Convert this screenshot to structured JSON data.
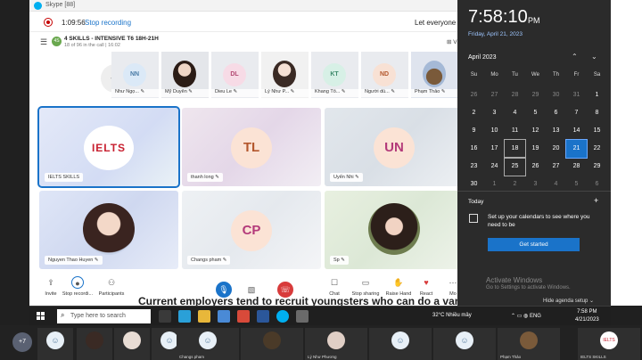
{
  "skype": {
    "window_title": "Skype [88]",
    "rec_time": "1:09:56",
    "stop_recording": "Stop recording",
    "marquee": "Let everyone kn",
    "group_name": "4 SKILLS - INTENSIVE T6 18H-21H",
    "group_sub": "18 of 96 in the call | 16:02",
    "group_avatar": "4S",
    "view_label": "Vi",
    "more_count": "+5"
  },
  "strip": [
    {
      "initials": "NN",
      "name": "Như Ngọ...",
      "color": "#dbe9f7",
      "text": "#4a7ba6"
    },
    {
      "initials": "",
      "name": "Mỹ Duyên",
      "color": "",
      "text": ""
    },
    {
      "initials": "DL",
      "name": "Dieu Le",
      "color": "#f7dbe6",
      "text": "#b34a73"
    },
    {
      "initials": "",
      "name": "Lý Như P...",
      "color": "",
      "text": ""
    },
    {
      "initials": "KT",
      "name": "Khang Tố...",
      "color": "#d7f0e6",
      "text": "#3f8a6c"
    },
    {
      "initials": "ND",
      "name": "Người dù...",
      "color": "#f8e1d4",
      "text": "#b3572d"
    },
    {
      "initials": "",
      "name": "Phạm Thảo",
      "color": "",
      "text": ""
    }
  ],
  "tiles": [
    {
      "name": "IELTS SKILLS",
      "initials": "IELTS"
    },
    {
      "name": "thanh long",
      "initials": "TL"
    },
    {
      "name": "Uyển Nhi",
      "initials": "UN"
    },
    {
      "name": "Nguyen Thao Huyen",
      "initials": ""
    },
    {
      "name": "Changs pham",
      "initials": "CP"
    },
    {
      "name": "Sp",
      "initials": ""
    }
  ],
  "controls": {
    "invite": "Invite",
    "stop_rec": "Stop recordi...",
    "participants": "Participants",
    "chat": "Chat",
    "stop_sharing": "Stop sharing",
    "raise_hand": "Raise Hand",
    "react": "React",
    "more": "Mo"
  },
  "background_text": "Current employers tend to recruit youngsters who can do a various am",
  "clock": {
    "time": "7:58:10",
    "ampm": "PM",
    "date": "Friday, April 21, 2023",
    "month": "April 2023",
    "dow": [
      "Su",
      "Mo",
      "Tu",
      "We",
      "Th",
      "Fr",
      "Sa"
    ],
    "weeks": [
      [
        "26",
        "27",
        "28",
        "29",
        "30",
        "31",
        "1"
      ],
      [
        "2",
        "3",
        "4",
        "5",
        "6",
        "7",
        "8"
      ],
      [
        "9",
        "10",
        "11",
        "12",
        "13",
        "14",
        "15"
      ],
      [
        "16",
        "17",
        "18",
        "19",
        "20",
        "21",
        "22"
      ],
      [
        "23",
        "24",
        "25",
        "26",
        "27",
        "28",
        "29"
      ],
      [
        "30",
        "1",
        "2",
        "3",
        "4",
        "5",
        "6"
      ]
    ],
    "today_label": "Today",
    "setup_text": "Set up your calendars to see where you need to be",
    "get_started": "Get started",
    "activate_title": "Activate Windows",
    "activate_sub": "Go to Settings to activate Windows.",
    "hide_agenda": "Hide agenda setup"
  },
  "taskbar": {
    "search_placeholder": "Type here to search",
    "weather": "32°C  Nhiều mây",
    "lang": "ENG",
    "time": "7:58 PM",
    "date": "4/21/2023"
  },
  "bottom": {
    "more": "+7",
    "names": [
      "Changs pham",
      "Lý Như Phương",
      "Phạm Thảo",
      "IELTS SKILLS"
    ]
  }
}
